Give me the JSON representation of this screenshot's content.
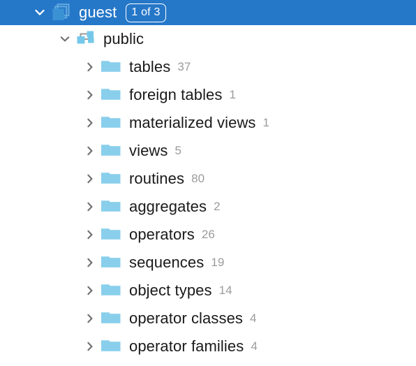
{
  "tree": {
    "root": {
      "label": "guest",
      "badge": "1 of 3",
      "icon": "stacked-databases-icon",
      "expanded_icon": "chevron-down-icon",
      "selected": true
    },
    "schema": {
      "label": "public",
      "icon": "schema-hierarchy-icon",
      "expanded_icon": "chevron-down-icon"
    },
    "items": [
      {
        "label": "tables",
        "count": "37",
        "icon": "folder-icon",
        "collapsed_icon": "chevron-right-icon"
      },
      {
        "label": "foreign tables",
        "count": "1",
        "icon": "folder-icon",
        "collapsed_icon": "chevron-right-icon"
      },
      {
        "label": "materialized views",
        "count": "1",
        "icon": "folder-icon",
        "collapsed_icon": "chevron-right-icon"
      },
      {
        "label": "views",
        "count": "5",
        "icon": "folder-icon",
        "collapsed_icon": "chevron-right-icon"
      },
      {
        "label": "routines",
        "count": "80",
        "icon": "folder-icon",
        "collapsed_icon": "chevron-right-icon"
      },
      {
        "label": "aggregates",
        "count": "2",
        "icon": "folder-icon",
        "collapsed_icon": "chevron-right-icon"
      },
      {
        "label": "operators",
        "count": "26",
        "icon": "folder-icon",
        "collapsed_icon": "chevron-right-icon"
      },
      {
        "label": "sequences",
        "count": "19",
        "icon": "folder-icon",
        "collapsed_icon": "chevron-right-icon"
      },
      {
        "label": "object types",
        "count": "14",
        "icon": "folder-icon",
        "collapsed_icon": "chevron-right-icon"
      },
      {
        "label": "operator classes",
        "count": "4",
        "icon": "folder-icon",
        "collapsed_icon": "chevron-right-icon"
      },
      {
        "label": "operator families",
        "count": "4",
        "icon": "folder-icon",
        "collapsed_icon": "chevron-right-icon"
      }
    ]
  },
  "colors": {
    "selection_blue": "#2577C8",
    "icon_light_blue": "#89CFEC",
    "stack_icon_blue": "#3A92D4",
    "chevron_gray": "#6e6e6e",
    "count_gray": "#9b9b9b",
    "label_black": "#1a1a1a",
    "background": "#ffffff"
  }
}
